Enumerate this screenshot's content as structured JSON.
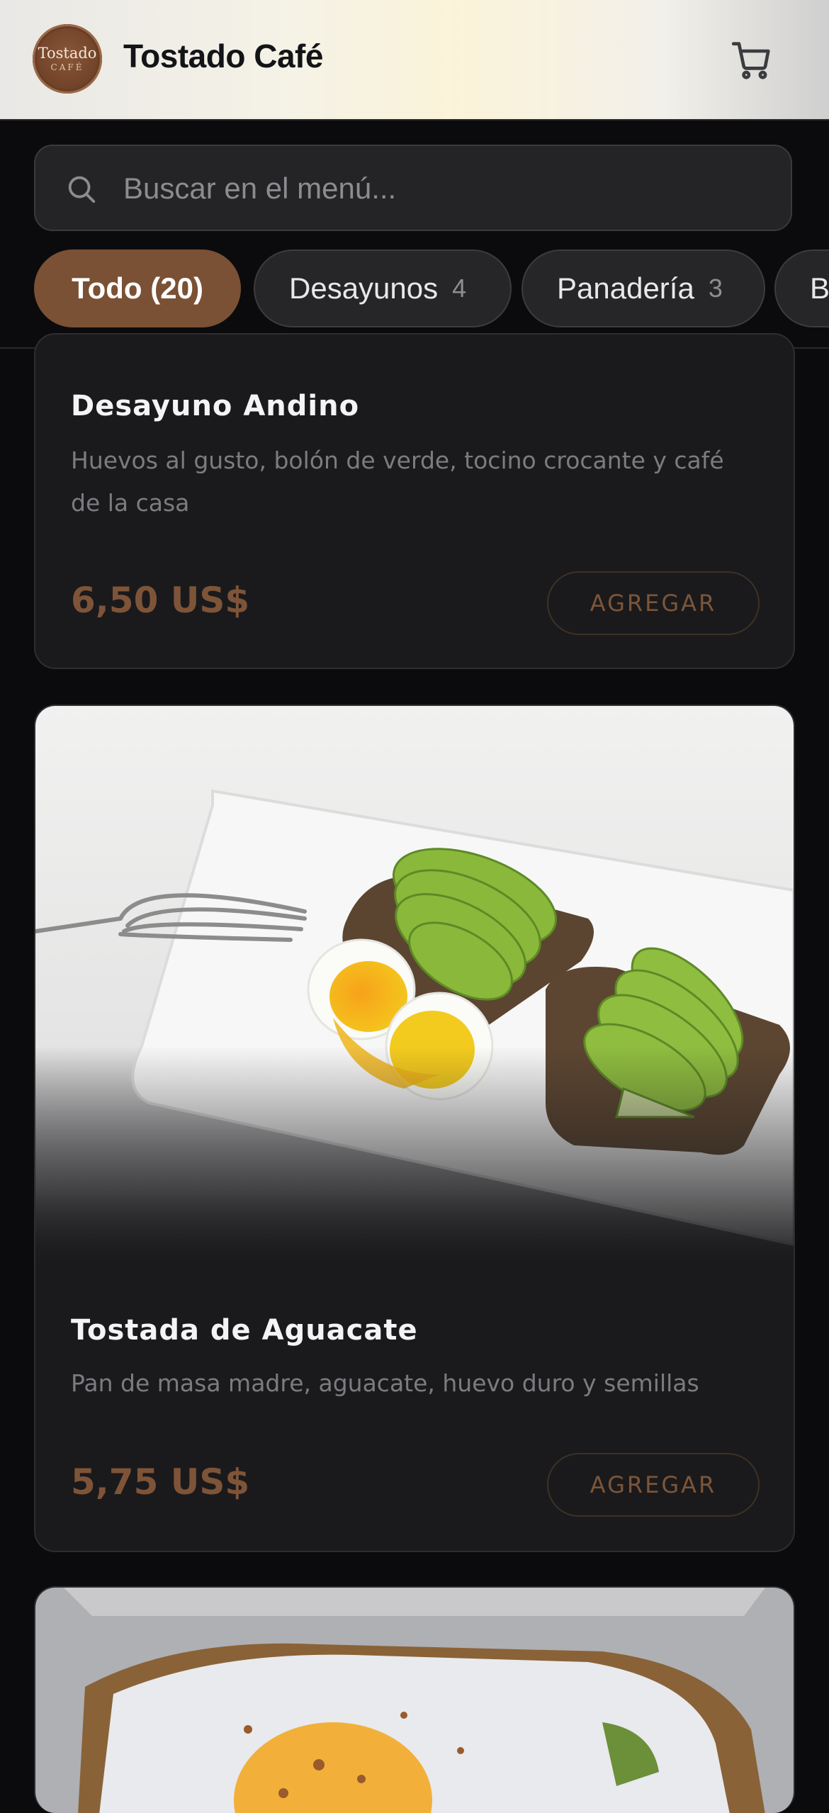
{
  "header": {
    "logo": {
      "line1": "Tostado",
      "line2": "CAFÉ"
    },
    "title": "Tostado Café",
    "cart_icon": "cart-icon"
  },
  "search": {
    "placeholder": "Buscar en el menú...",
    "icon": "search-icon"
  },
  "categories": [
    {
      "label": "Todo (20)",
      "count": "",
      "active": true
    },
    {
      "label": "Desayunos",
      "count": "4",
      "active": false
    },
    {
      "label": "Panadería",
      "count": "3",
      "active": false
    },
    {
      "label": "B",
      "count": "",
      "active": false
    }
  ],
  "products": [
    {
      "name": "Desayuno Andino",
      "description": "Huevos al gusto, bolón de verde, tocino crocante y café de la casa",
      "price": "6,50 US$",
      "button": "AGREGAR"
    },
    {
      "name": "Tostada de Aguacate",
      "description": "Pan de masa madre, aguacate, huevo duro y semillas",
      "price": "5,75 US$",
      "button": "AGREGAR"
    }
  ],
  "colors": {
    "accent": "#7a5134",
    "price": "#7e5438",
    "background": "#0b0b0d",
    "card": "#1a1a1c"
  }
}
